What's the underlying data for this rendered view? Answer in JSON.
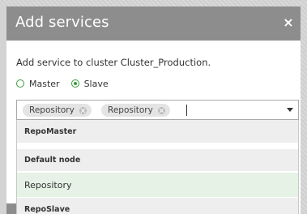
{
  "dialog": {
    "title": "Add services",
    "close_glyph": "×"
  },
  "description": "Add service to cluster Cluster_Production.",
  "role": {
    "options": [
      {
        "label": "Master",
        "selected": false
      },
      {
        "label": "Slave",
        "selected": true
      }
    ]
  },
  "select": {
    "tags": [
      "Repository",
      "Repository"
    ],
    "caret_icon": "chevron-down-icon"
  },
  "dropdown": {
    "groups": [
      {
        "label": "RepoMaster"
      },
      {
        "label": "Default node"
      },
      {
        "label": "Repository",
        "highlighted": true
      },
      {
        "label": "RepoSlave"
      }
    ]
  },
  "colors": {
    "header": "#8d8d8d",
    "accent": "#3a9a3a",
    "highlight": "#e5f2e5"
  }
}
